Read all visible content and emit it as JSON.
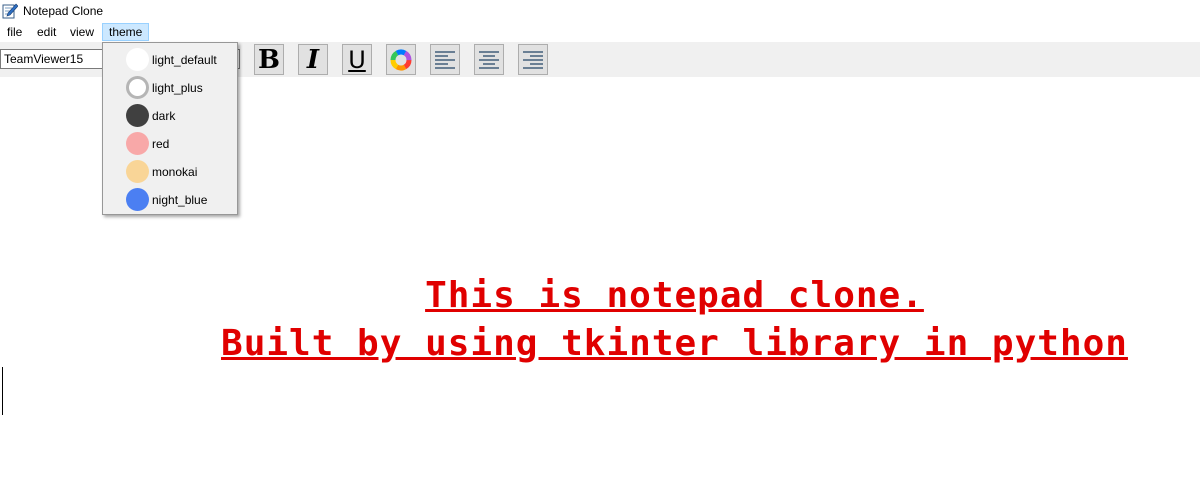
{
  "window": {
    "title": "Notepad Clone"
  },
  "menubar": {
    "items": [
      "file",
      "edit",
      "view",
      "theme"
    ],
    "active": "theme"
  },
  "toolbar": {
    "font_family_value": "TeamViewer15",
    "bold_label": "B",
    "italic_label": "I",
    "underline_label": "U"
  },
  "theme_menu": {
    "items": [
      {
        "label": "light_default",
        "color": "#ffffff",
        "ring": false
      },
      {
        "label": "light_plus",
        "color": "#ffffff",
        "ring": true
      },
      {
        "label": "dark",
        "color": "#404040",
        "ring": false
      },
      {
        "label": "red",
        "color": "#f8a8a8",
        "ring": false
      },
      {
        "label": "monokai",
        "color": "#f9d597",
        "ring": false
      },
      {
        "label": "night_blue",
        "color": "#4b7ff2",
        "ring": false
      }
    ]
  },
  "editor": {
    "lines": [
      "This is notepad clone.",
      "Built by using tkinter library in python"
    ],
    "text_color": "#e00000"
  },
  "icons": {
    "app": "notepad-pencil-icon",
    "color": "color-wheel-icon",
    "align_left": "align-left-icon",
    "align_center": "align-center-icon",
    "align_right": "align-right-icon"
  }
}
